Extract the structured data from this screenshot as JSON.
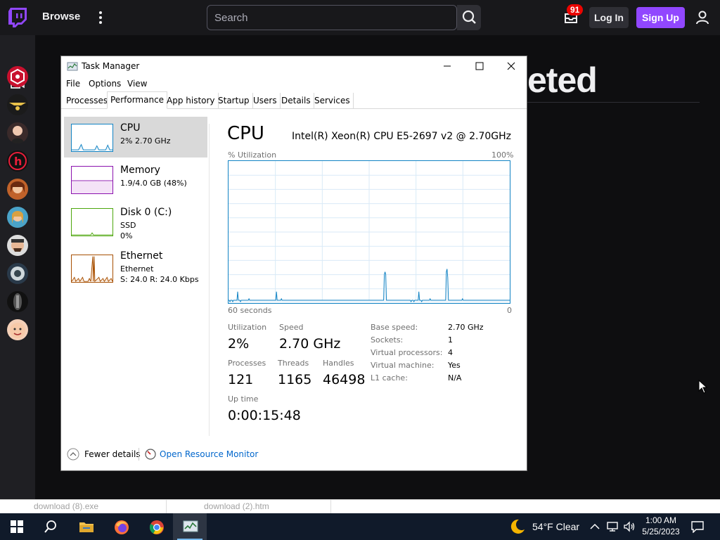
{
  "twitch": {
    "browse": "Browse",
    "search_placeholder": "Search",
    "notification_count": "91",
    "login": "Log In",
    "signup": "Sign Up",
    "page_heading_fragment": "eted",
    "accent": "#9147ff"
  },
  "download_bar": {
    "item1": "download (8).exe",
    "item2": "download (2).htm"
  },
  "task_manager": {
    "title": "Task Manager",
    "menu": [
      "File",
      "Options",
      "View"
    ],
    "tabs": [
      "Processes",
      "Performance",
      "App history",
      "Startup",
      "Users",
      "Details",
      "Services"
    ],
    "active_tab": "Performance",
    "sidebar": [
      {
        "name": "CPU",
        "line1": "2% 2.70 GHz",
        "line2": ""
      },
      {
        "name": "Memory",
        "line1": "1.9/4.0 GB (48%)",
        "line2": ""
      },
      {
        "name": "Disk 0 (C:)",
        "line1": "SSD",
        "line2": "0%"
      },
      {
        "name": "Ethernet",
        "line1": "Ethernet",
        "line2": "S: 24.0  R: 24.0 Kbps"
      }
    ],
    "heading": "CPU",
    "cpu_model": "Intel(R) Xeon(R) CPU E5-2697 v2 @ 2.70GHz",
    "graph": {
      "y_label": "% Utilization",
      "y_max_label": "100%",
      "x_left_label": "60 seconds",
      "x_right_label": "0",
      "history_percent": [
        2,
        2,
        1,
        2,
        2,
        2,
        1,
        2,
        2,
        2,
        2,
        2,
        2,
        8,
        2,
        2,
        2,
        1,
        2,
        2,
        2,
        2,
        2,
        2,
        2,
        2,
        2,
        2,
        2,
        3,
        2,
        2,
        2,
        2,
        2,
        2,
        2,
        2,
        2,
        2,
        2,
        2,
        2,
        2,
        2,
        2,
        2,
        2,
        2,
        2,
        2,
        2,
        2,
        2,
        2,
        2,
        2,
        2,
        2,
        2,
        2,
        2,
        2,
        2,
        2,
        2,
        2,
        2,
        2,
        2,
        2,
        2,
        2,
        2,
        2,
        3,
        2,
        2,
        2,
        2,
        2,
        2,
        2,
        2,
        2,
        2,
        2,
        2,
        2,
        2,
        2,
        2,
        2,
        2,
        2,
        2,
        2,
        2,
        2,
        2,
        2,
        2,
        2,
        2,
        2,
        2,
        2,
        2,
        2,
        2,
        2,
        2,
        2,
        2,
        2,
        2,
        2,
        2,
        2,
        2,
        2,
        2,
        2,
        2,
        2,
        2,
        2,
        2,
        2,
        2,
        2,
        2,
        2,
        2,
        2,
        2,
        2,
        2,
        2,
        2,
        2,
        2,
        2,
        2,
        2,
        2,
        2,
        2,
        2,
        2,
        2,
        2,
        2,
        2,
        2,
        2,
        2,
        2,
        2,
        2,
        2,
        2,
        2,
        2,
        2,
        2,
        2,
        2,
        2,
        2,
        2,
        2,
        2,
        2,
        2,
        2,
        2,
        2,
        2,
        2,
        2,
        2,
        2,
        2,
        2,
        2,
        2,
        2,
        2,
        2,
        2,
        2,
        2,
        2,
        2,
        2,
        2,
        2,
        2,
        2,
        2,
        2,
        2,
        2,
        2,
        2,
        2,
        2,
        2,
        2,
        2,
        2,
        2,
        2,
        2,
        2,
        2,
        2,
        2,
        2,
        2,
        2,
        2,
        2,
        2,
        2,
        2,
        2,
        2,
        2,
        2,
        2,
        2,
        2,
        2,
        2,
        2,
        2,
        2,
        2,
        2,
        2,
        2,
        2,
        2,
        2,
        2,
        2,
        2,
        2,
        2,
        2,
        2,
        2,
        2,
        2,
        2
      ]
    },
    "stats": {
      "utilization_label": "Utilization",
      "utilization": "2%",
      "speed_label": "Speed",
      "speed": "2.70 GHz",
      "processes_label": "Processes",
      "processes": "121",
      "threads_label": "Threads",
      "threads": "1165",
      "handles_label": "Handles",
      "handles": "46498",
      "uptime_label": "Up time",
      "uptime": "0:00:15:48"
    },
    "details": [
      {
        "k": "Base speed:",
        "v": "2.70 GHz"
      },
      {
        "k": "Sockets:",
        "v": "1"
      },
      {
        "k": "Virtual processors:",
        "v": "4"
      },
      {
        "k": "Virtual machine:",
        "v": "Yes"
      },
      {
        "k": "L1 cache:",
        "v": "N/A"
      }
    ],
    "fewer_details": "Fewer details",
    "open_resource_monitor": "Open Resource Monitor"
  },
  "taskbar": {
    "weather": "54°F  Clear",
    "time": "1:00 AM",
    "date": "5/25/2023"
  },
  "icons": [
    "twitch-logo-icon",
    "kebab-icon",
    "search-icon",
    "inbox-icon",
    "user-icon",
    "camera-icon",
    "windows-start-icon",
    "search-icon",
    "file-explorer-icon",
    "firefox-icon",
    "chrome-icon",
    "task-manager-icon",
    "moon-icon",
    "chevron-up-icon",
    "network-icon",
    "volume-icon",
    "notification-icon",
    "minimize-icon",
    "maximize-icon",
    "close-icon",
    "chevron-up-circle-icon",
    "resource-monitor-icon",
    "mouse-cursor-icon"
  ]
}
